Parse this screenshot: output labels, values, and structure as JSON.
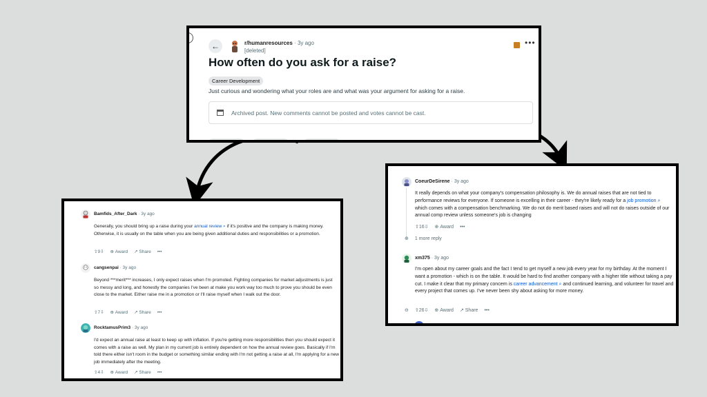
{
  "post": {
    "subreddit": "r/humanresources",
    "age": "3y ago",
    "author": "[deleted]",
    "title": "How often do you ask for a raise?",
    "flair": "Career Development",
    "body": "Just curious and wondering what your roles are and what was your argument for asking for a raise.",
    "archived_notice": "Archived post. New comments cannot be posted and votes cannot be cast.",
    "more": "•••"
  },
  "left_comments": [
    {
      "user": "Bamfids_After_Dark",
      "age": "3y ago",
      "body_pre": "Generally, you should bring up a raise during your ",
      "body_link": "annual review",
      "body_post": " if it's positive and the company is making money. Otherwise, it is usually on the table when you are being given additional duties and responsibilities or a promotion.",
      "votes": "9",
      "award": "Award",
      "share": "Share",
      "more": "•••"
    },
    {
      "user": "cangsenpai",
      "age": "3y ago",
      "body": "Beyond ***merit*** increases, I only expect raises when I'm promoted. Fighting companies for market adjustments is just so messy and long, and honestly the companies I've been at make you work way too much to prove you should be even close to the market. Either raise me in a promotion or I'll raise myself when I walk out the door.",
      "votes": "7",
      "award": "Award",
      "share": "Share",
      "more": "•••"
    },
    {
      "user": "RocktamusPrim3",
      "age": "3y ago",
      "body": "I'd expect an annual raise at least to keep up with inflation. If you're getting more responsibilities then you should expect it comes with a raise as well. My plan in my current job is entirely dependent on how the annual review goes. Basically if I'm told there either isn't room in the budget or something similar ending with I'm not getting a raise at all, I'm applying for a new job immediately after the meeting.",
      "votes": "4",
      "award": "Award",
      "share": "Share",
      "more": "•••"
    }
  ],
  "right_comments": [
    {
      "user": "CoeurDeSirene",
      "age": "3y ago",
      "body_pre": "It really depends on what your company's compensation philosophy is. We do annual raises that are not tied to performance reviews for everyone. If someone is excelling in their career - they're likely ready for a ",
      "body_link": "job promotion",
      "body_post": " which comes with a compensation benchmarking. We do not do merit based raises and will not do raises outside of our annual comp review unless someone's job is changing",
      "votes": "16",
      "award": "Award",
      "more": "•••",
      "replies": "1 more reply"
    },
    {
      "user": "xm375",
      "age": "3y ago",
      "body_pre": "I'm open about my career goals and the fact I tend to get myself a new job every year for my birthday. At the moment I want a promotion - which is on the table. It would be hard to find another company with a higher title without taking a pay cut. I make it clear that my primary concern is ",
      "body_link": "career advancement",
      "body_post": " and continued learning, and volunteer for travel and every project that comes up. I've never been shy about asking for more money.",
      "votes": "26",
      "award": "Award",
      "share": "Share",
      "more": "•••"
    }
  ],
  "colors": {
    "link": "#0a58ca",
    "meta": "#576f76",
    "frame": "#000000",
    "background": "#dcdedd"
  }
}
